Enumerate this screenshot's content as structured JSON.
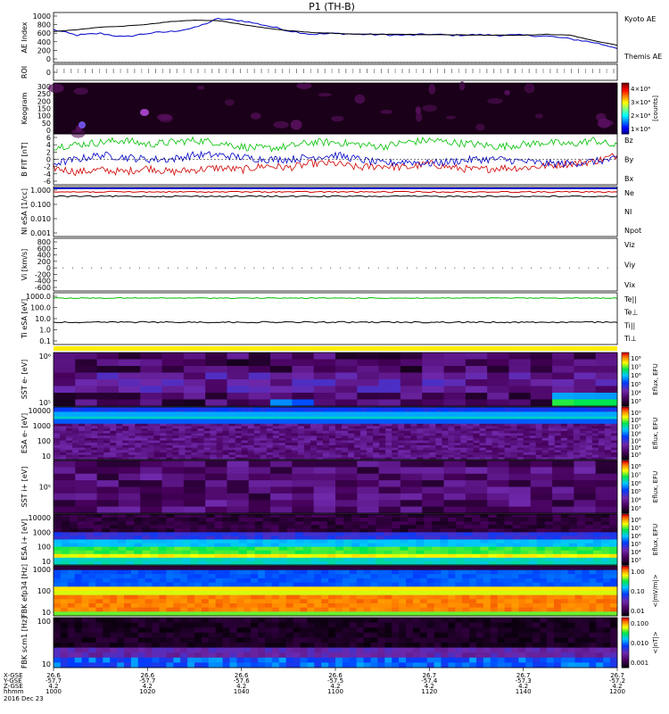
{
  "title": "P1 (TH-B)",
  "colors": {
    "ae_kyoto": "#0000c8",
    "ae_themis": "#000000",
    "red": "#d00000",
    "green": "#00c000",
    "blue": "#0000c8",
    "black": "#000000"
  },
  "panels": [
    {
      "id": "ae",
      "ylabel": "AE Index",
      "ticks": [
        "1000",
        "800",
        "600",
        "400",
        "200",
        "0"
      ],
      "legend": [
        {
          "text": "Kyoto AE",
          "color": "#0000c8"
        },
        {
          "text": "Themis AE",
          "color": "#000000"
        }
      ]
    },
    {
      "id": "roi",
      "ylabel": "ROI",
      "ticks": [
        "0"
      ]
    },
    {
      "id": "keogram",
      "ylabel": "Keogram",
      "ticks": [
        "300",
        "250",
        "200",
        "150",
        "100",
        "50",
        "0"
      ],
      "cbar_ticks": [
        "4×10⁴",
        "3×10⁴",
        "2×10⁴",
        "1×10⁴"
      ],
      "cbar_label": "[counts]"
    },
    {
      "id": "bfield",
      "ylabel": "B FIT [nT]",
      "ticks": [
        "6",
        "4",
        "2",
        "0",
        "-2",
        "-4",
        "-6"
      ],
      "legend": [
        {
          "text": "Bz",
          "color": "#d00000"
        },
        {
          "text": "By",
          "color": "#00c000"
        },
        {
          "text": "Bx",
          "color": "#0000c8"
        }
      ]
    },
    {
      "id": "dens",
      "ylabel": "NI eSA [1/cc]",
      "ticks": [
        "1.000",
        "0.100",
        "0.010",
        "0.001"
      ],
      "legend": [
        {
          "text": "Ne",
          "color": "#d00000"
        },
        {
          "text": "NI",
          "color": "#000000"
        },
        {
          "text": "Npot",
          "color": "#0000c8"
        }
      ]
    },
    {
      "id": "vel",
      "ylabel": "Vi [km/s]",
      "ticks": [
        "800",
        "600",
        "400",
        "200",
        "0",
        "-200",
        "-400",
        "-600"
      ],
      "legend": [
        {
          "text": "Viz",
          "color": "#d00000"
        },
        {
          "text": "Viy",
          "color": "#00c000"
        },
        {
          "text": "Vix",
          "color": "#0000c8"
        }
      ]
    },
    {
      "id": "temp",
      "ylabel": "Ti eSA [eV]",
      "ticks": [
        "1000.0",
        "100.0",
        "10.0",
        "1.0",
        "0.1"
      ],
      "legend": [
        {
          "text": "Te||",
          "color": "#000000"
        },
        {
          "text": "Te⊥",
          "color": "#d00000"
        },
        {
          "text": "Ti||",
          "color": "#00c000"
        },
        {
          "text": "Ti⊥",
          "color": "#0000c8"
        }
      ]
    },
    {
      "id": "sst_e",
      "ylabel": "SST e- [eV]",
      "ticks": [
        "10⁶",
        "10⁵"
      ],
      "cbar_ticks": [
        "10⁸",
        "10⁷",
        "10⁶",
        "10⁵",
        "10⁴",
        "10³"
      ],
      "cbar_label": "Eflux, EFU"
    },
    {
      "id": "esa_e",
      "ylabel": "ESA e- [eV]",
      "ticks": [
        "10000",
        "1000",
        "100",
        "10"
      ],
      "cbar_ticks": [
        "10⁹",
        "10⁸",
        "10⁷",
        "10⁶",
        "10⁵",
        "10⁴",
        "10³"
      ],
      "cbar_label": "Eflux, EFU"
    },
    {
      "id": "sst_i",
      "ylabel": "SST i+ [eV]",
      "ticks": [
        "10⁵"
      ],
      "cbar_ticks": [
        "10⁸",
        "10⁷",
        "10⁶",
        "10⁵",
        "10⁴",
        "10³"
      ],
      "cbar_label": "Eflux, EFU"
    },
    {
      "id": "esa_i",
      "ylabel": "ESA i+ [eV]",
      "ticks": [
        "10000",
        "1000",
        "100",
        "10"
      ],
      "cbar_ticks": [
        "10⁸",
        "10⁷",
        "10⁶",
        "10⁵",
        "10⁴",
        "10³"
      ],
      "cbar_label": "Eflux, EFU"
    },
    {
      "id": "fbk_e",
      "ylabel": "FBK efp34 [Hz]",
      "ticks": [
        "1000",
        "100",
        "10"
      ],
      "cbar_ticks": [
        "1.00",
        "0.10",
        "0.01"
      ],
      "cbar_label": "<|mV/m|>"
    },
    {
      "id": "fbk_b",
      "ylabel": "FBK scm1 [Hz]",
      "ticks": [
        "100",
        "10"
      ],
      "cbar_ticks": [
        "0.100",
        "0.010",
        "0.001"
      ],
      "cbar_label": "<|nT|>"
    }
  ],
  "chart_data": {
    "type": "heatmap",
    "title": "P1 (TH-B)",
    "ae": {
      "type": "line",
      "ylim": [
        0,
        1100
      ],
      "ylabel": "AE Index",
      "x": [
        "10:00",
        "10:05",
        "10:10",
        "10:15",
        "10:20",
        "10:25",
        "10:30",
        "10:35",
        "10:40",
        "10:45",
        "10:50",
        "10:55",
        "11:00",
        "11:05",
        "11:10",
        "11:15",
        "11:20",
        "11:25",
        "11:30",
        "11:35",
        "11:40",
        "11:45",
        "11:50",
        "11:55",
        "12:00"
      ],
      "series": [
        {
          "name": "Kyoto AE",
          "values": [
            720,
            600,
            640,
            560,
            640,
            680,
            760,
            960,
            920,
            820,
            700,
            620,
            640,
            620,
            610,
            600,
            620,
            600,
            610,
            600,
            600,
            580,
            520,
            440,
            320
          ]
        },
        {
          "name": "Themis AE",
          "values": [
            680,
            720,
            780,
            800,
            840,
            900,
            930,
            920,
            840,
            760,
            700,
            660,
            640,
            620,
            620,
            620,
            610,
            610,
            600,
            600,
            600,
            620,
            600,
            480,
            380
          ]
        }
      ]
    },
    "bfield": {
      "type": "line",
      "ylim": [
        -6,
        6
      ],
      "ylabel": "B FIT [nT]",
      "x": [
        "10:00",
        "10:05",
        "10:10",
        "10:15",
        "10:20",
        "10:25",
        "10:30",
        "10:35",
        "10:40",
        "10:45",
        "10:50",
        "10:55",
        "11:00",
        "11:05",
        "11:10",
        "11:15",
        "11:20",
        "11:25",
        "11:30",
        "11:35",
        "11:40",
        "11:45",
        "11:50",
        "11:55",
        "12:00"
      ],
      "series": [
        {
          "name": "Bz",
          "values": [
            -2,
            -3,
            -2.5,
            -3,
            -2,
            -3,
            -2.5,
            -2,
            -2.5,
            -1.5,
            -2,
            -1,
            -1,
            -2,
            -1.5,
            -2,
            -1,
            -2,
            -2.5,
            -2,
            -2,
            -1.5,
            -1,
            -0.5,
            1
          ]
        },
        {
          "name": "By",
          "values": [
            3,
            3.5,
            4,
            4.5,
            3.5,
            4,
            4.5,
            4,
            3,
            2.5,
            3,
            4,
            4,
            3.5,
            3,
            4,
            4.5,
            4,
            3.5,
            3,
            3.5,
            4,
            3.5,
            4.5,
            3
          ]
        },
        {
          "name": "Bx",
          "values": [
            -1,
            0,
            1,
            0.5,
            0,
            0,
            1,
            1,
            0.5,
            0,
            0,
            0.5,
            1,
            0,
            -1,
            -0.5,
            -1,
            -0.5,
            0,
            0,
            -0.5,
            -1,
            -1,
            -0.5,
            0
          ]
        }
      ]
    },
    "orbit": {
      "labels": [
        "X-GSE",
        "Y-GSE",
        "Z-GSE",
        "hhmm",
        "2016 Dec 23"
      ],
      "x_ticks": [
        {
          "x": "26.6",
          "y": "-57.7",
          "z": "4.2",
          "t": "1000"
        },
        {
          "x": "26.6",
          "y": "-57.7",
          "z": "4.2",
          "t": "1020"
        },
        {
          "x": "26.6",
          "y": "-57.6",
          "z": "4.2",
          "t": "1040"
        },
        {
          "x": "26.6",
          "y": "-57.5",
          "z": "4.2",
          "t": "1100"
        },
        {
          "x": "26.7",
          "y": "-57.4",
          "z": "4.2",
          "t": "1120"
        },
        {
          "x": "26.7",
          "y": "-57.3",
          "z": "4.2",
          "t": "1140"
        },
        {
          "x": "26.7",
          "y": "-57.2",
          "z": "4.2",
          "t": "1200"
        }
      ]
    }
  }
}
